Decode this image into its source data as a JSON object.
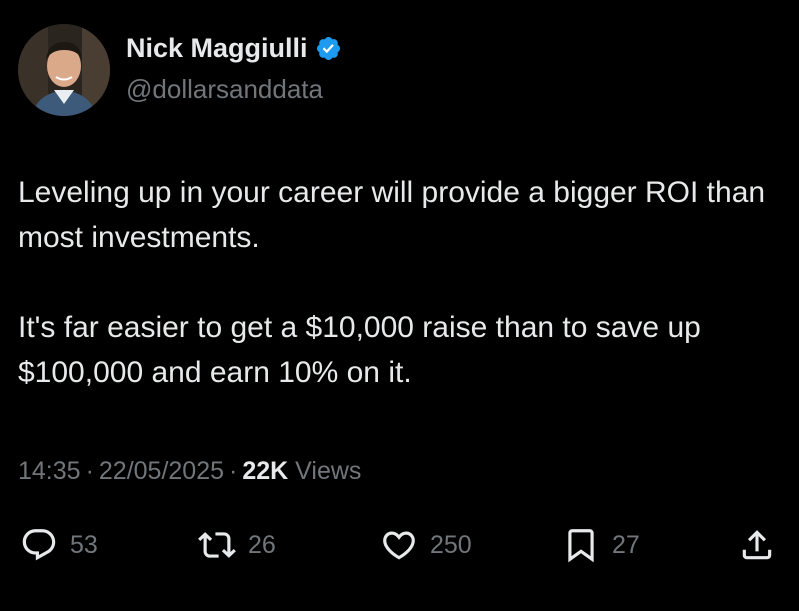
{
  "author": {
    "name": "Nick Maggiulli",
    "handle": "@dollarsanddata",
    "verified": true,
    "verified_color": "#1d9bf0"
  },
  "tweet": {
    "paragraphs": [
      "Leveling up in your career will provide a bigger ROI than most investments.",
      "It's far easier to get a $10,000 raise than to save up $100,000 and earn 10% on it."
    ],
    "time": "14:35",
    "date": "22/05/2025",
    "views_count": "22K",
    "views_label": "Views"
  },
  "actions": {
    "reply_count": "53",
    "retweet_count": "26",
    "like_count": "250",
    "bookmark_count": "27"
  },
  "icons": {
    "reply": "reply-icon",
    "retweet": "retweet-icon",
    "like": "heart-icon",
    "bookmark": "bookmark-icon",
    "share": "share-icon",
    "verified": "verified-badge-icon"
  },
  "colors": {
    "background": "#000000",
    "text_primary": "#e7e9ea",
    "text_secondary": "#71767b",
    "accent": "#1d9bf0"
  }
}
